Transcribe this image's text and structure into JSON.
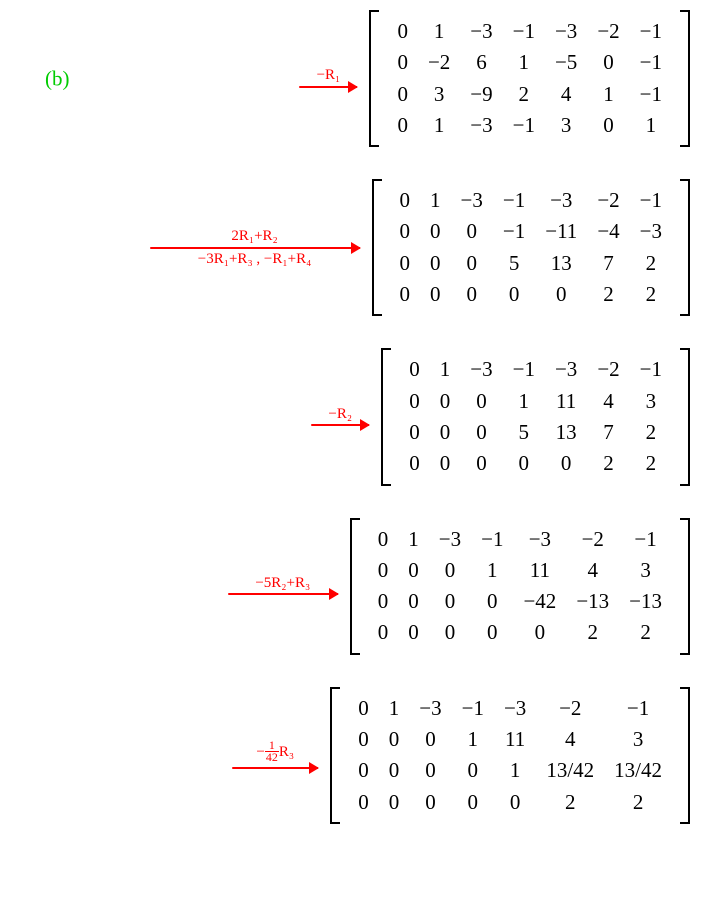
{
  "part_label": "(b)",
  "chart_data": [
    {
      "type": "table",
      "operation_top": "−R₁",
      "operation_bottom": "",
      "arrow_width": 58,
      "rows": [
        [
          "0",
          "1",
          "−3",
          "−1",
          "−3",
          "−2",
          "−1"
        ],
        [
          "0",
          "−2",
          "6",
          "1",
          "−5",
          "0",
          "−1"
        ],
        [
          "0",
          "3",
          "−9",
          "2",
          "4",
          "1",
          "−1"
        ],
        [
          "0",
          "1",
          "−3",
          "−1",
          "3",
          "0",
          "1"
        ]
      ]
    },
    {
      "type": "table",
      "operation_top": "2R₁+R₂",
      "operation_bottom": "−3R₁+R₃ , −R₁+R₄",
      "arrow_width": 210,
      "rows": [
        [
          "0",
          "1",
          "−3",
          "−1",
          "−3",
          "−2",
          "−1"
        ],
        [
          "0",
          "0",
          "0",
          "−1",
          "−11",
          "−4",
          "−3"
        ],
        [
          "0",
          "0",
          "0",
          "5",
          "13",
          "7",
          "2"
        ],
        [
          "0",
          "0",
          "0",
          "0",
          "0",
          "2",
          "2"
        ]
      ]
    },
    {
      "type": "table",
      "operation_top": "−R₂",
      "operation_bottom": "",
      "arrow_width": 58,
      "rows": [
        [
          "0",
          "1",
          "−3",
          "−1",
          "−3",
          "−2",
          "−1"
        ],
        [
          "0",
          "0",
          "0",
          "1",
          "11",
          "4",
          "3"
        ],
        [
          "0",
          "0",
          "0",
          "5",
          "13",
          "7",
          "2"
        ],
        [
          "0",
          "0",
          "0",
          "0",
          "0",
          "2",
          "2"
        ]
      ]
    },
    {
      "type": "table",
      "operation_top": "−5R₂+R₃",
      "operation_bottom": "",
      "arrow_width": 110,
      "rows": [
        [
          "0",
          "1",
          "−3",
          "−1",
          "−3",
          "−2",
          "−1"
        ],
        [
          "0",
          "0",
          "0",
          "1",
          "11",
          "4",
          "3"
        ],
        [
          "0",
          "0",
          "0",
          "0",
          "−42",
          "−13",
          "−13"
        ],
        [
          "0",
          "0",
          "0",
          "0",
          "0",
          "2",
          "2"
        ]
      ]
    },
    {
      "type": "table",
      "operation_html": "−<span style='display:inline-block;vertical-align:middle;text-align:center;line-height:0.95;font-size:12px;padding-bottom:1px;'><span style='display:block;border-bottom:1px solid #ff0000;padding:0 1px;'>1</span><span style='display:block;padding:0 1px;'>42</span></span>R₃",
      "operation_bottom": "",
      "arrow_width": 86,
      "rows": [
        [
          "0",
          "1",
          "−3",
          "−1",
          "−3",
          "−2",
          "−1"
        ],
        [
          "0",
          "0",
          "0",
          "1",
          "11",
          "4",
          "3"
        ],
        [
          "0",
          "0",
          "0",
          "0",
          "1",
          "13/42",
          "13/42"
        ],
        [
          "0",
          "0",
          "0",
          "0",
          "0",
          "2",
          "2"
        ]
      ]
    }
  ]
}
